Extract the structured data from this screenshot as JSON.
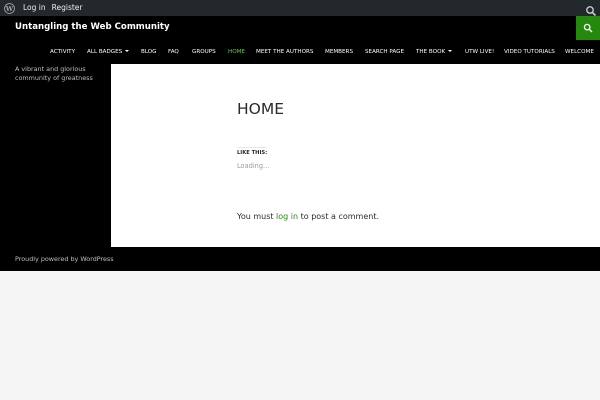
{
  "adminbar": {
    "logo_icon": "wordpress-logo-icon",
    "login_label": "Log in",
    "register_label": "Register",
    "search_icon": "search-icon"
  },
  "header": {
    "site_title": "Untangling the Web Community",
    "search_icon": "search-icon",
    "accent_color": "#24890d"
  },
  "nav": {
    "items": [
      {
        "label": "ACTIVITY"
      },
      {
        "label": "ALL BADGES"
      },
      {
        "label": "BLOG"
      },
      {
        "label": "FAQ"
      },
      {
        "label": "GROUPS"
      },
      {
        "label": "HOME"
      },
      {
        "label": "MEET THE AUTHORS"
      },
      {
        "label": "MEMBERS"
      },
      {
        "label": "SEARCH PAGE"
      },
      {
        "label": "THE BOOK"
      },
      {
        "label": "UTW LIVE!"
      },
      {
        "label": "VIDEO TUTORIALS"
      },
      {
        "label": "WELCOME"
      }
    ]
  },
  "sidebar": {
    "tagline": "A vibrant and glorious community of greatness"
  },
  "content": {
    "title": "HOME",
    "like_heading": "LIKE THIS:",
    "loading_text": "Loading...",
    "comment_prefix": "You must",
    "comment_link": "log in",
    "comment_suffix": "to post a comment."
  },
  "footer": {
    "credit": "Proudly powered by WordPress"
  }
}
